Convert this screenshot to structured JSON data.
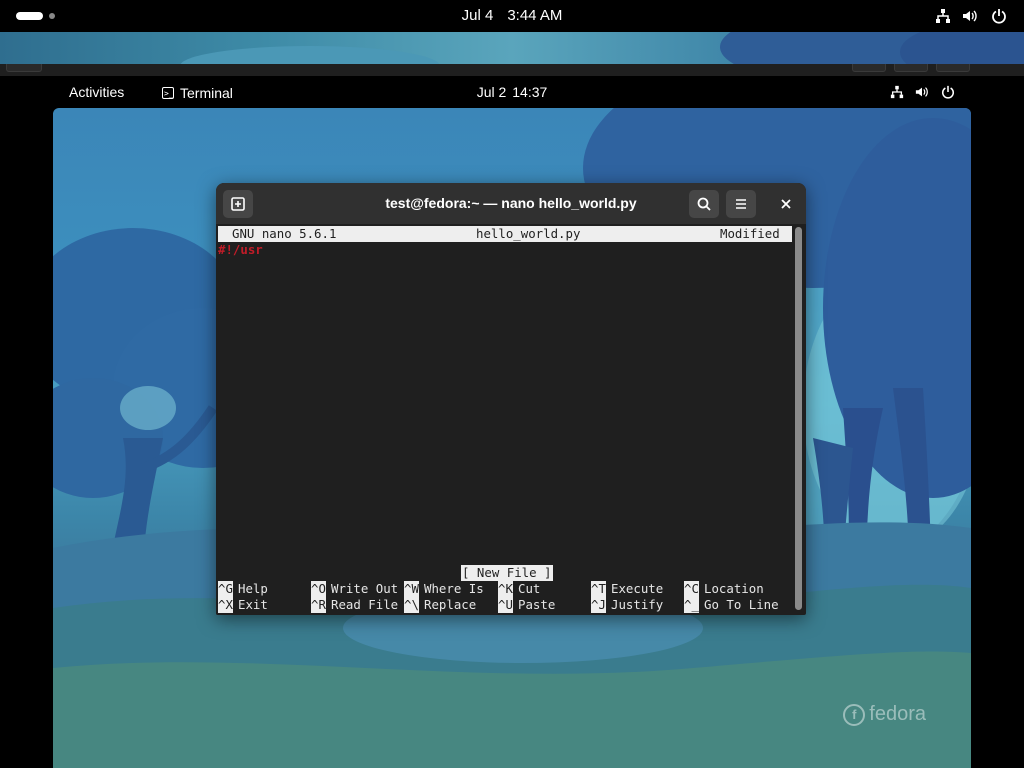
{
  "host": {
    "date": "Jul 4",
    "time": "3:44 AM",
    "tray_icons": [
      "network-icon",
      "volume-icon",
      "power-icon"
    ]
  },
  "vm_topbar": {
    "activities": "Activities",
    "app_name": "Terminal",
    "date": "Jul 2",
    "time": "14:37",
    "tray_icons": [
      "network-icon",
      "volume-icon",
      "power-icon"
    ]
  },
  "terminal": {
    "title": "test@fedora:~ — nano hello_world.py",
    "header_buttons": [
      "new-tab-icon",
      "search-icon",
      "menu-icon",
      "close-icon"
    ]
  },
  "nano": {
    "version": "GNU nano 5.6.1",
    "filename": "hello_world.py",
    "state": "Modified",
    "content": "#!/usr",
    "status": "[ New File ]",
    "shortcuts_row1": [
      {
        "key": "^G",
        "label": "Help"
      },
      {
        "key": "^O",
        "label": "Write Out"
      },
      {
        "key": "^W",
        "label": "Where Is"
      },
      {
        "key": "^K",
        "label": "Cut"
      },
      {
        "key": "^T",
        "label": "Execute"
      },
      {
        "key": "^C",
        "label": "Location"
      }
    ],
    "shortcuts_row2": [
      {
        "key": "^X",
        "label": "Exit"
      },
      {
        "key": "^R",
        "label": "Read File"
      },
      {
        "key": "^\\",
        "label": "Replace"
      },
      {
        "key": "^U",
        "label": "Paste"
      },
      {
        "key": "^J",
        "label": "Justify"
      },
      {
        "key": "^_",
        "label": "Go To Line"
      }
    ]
  },
  "wallpaper": {
    "brand": "fedora"
  },
  "colors": {
    "nano_text_red": "#c01c28",
    "terminal_bg": "#1f1f1f",
    "header_bg": "#303030"
  }
}
